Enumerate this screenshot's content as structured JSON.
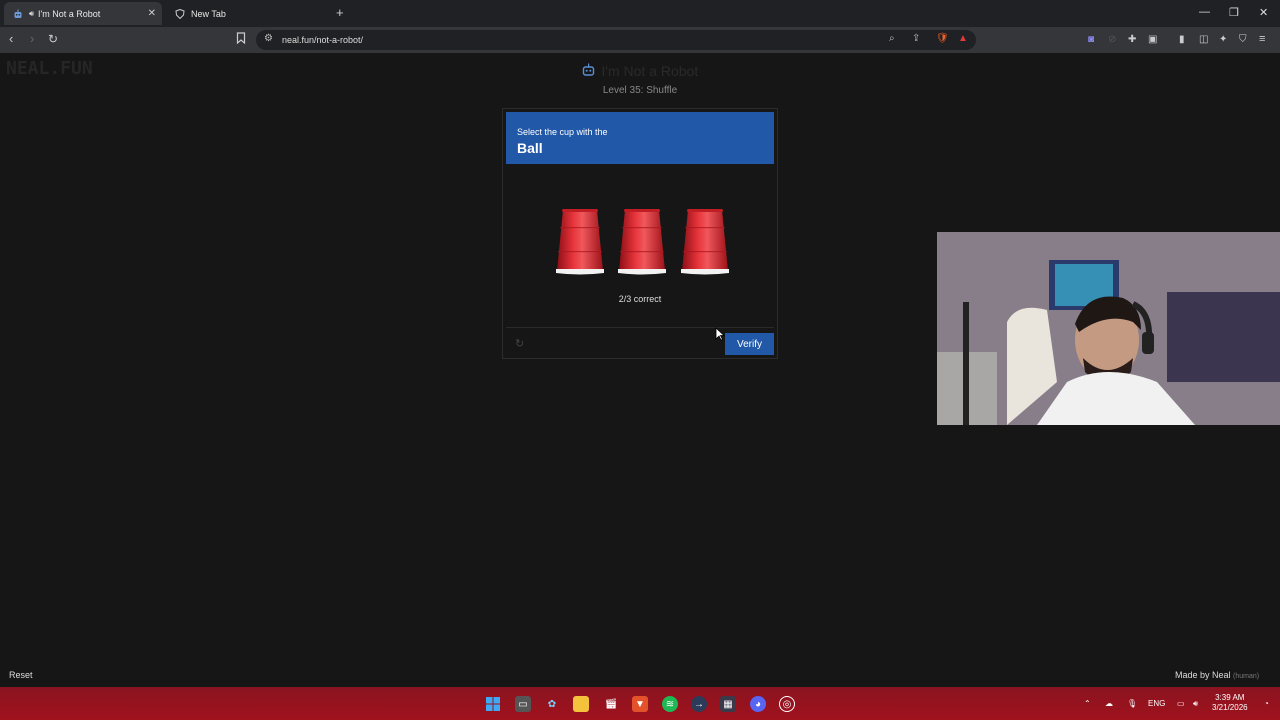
{
  "browser": {
    "tabs": [
      {
        "title": "I'm Not a Robot",
        "active": true
      },
      {
        "title": "New Tab",
        "active": false
      }
    ],
    "url": "neal.fun/not-a-robot/"
  },
  "page": {
    "logo": "NEAL.FUN",
    "title": "I'm Not a Robot",
    "level": "Level 35: Shuffle",
    "captcha": {
      "instruction": "Select the cup with the",
      "target": "Ball",
      "cups": 3,
      "status": "2/3 correct",
      "verify_label": "Verify"
    },
    "reset_label": "Reset",
    "made_by": "Made by Neal",
    "made_by_note": "(human)"
  },
  "taskbar": {
    "language": "ENG",
    "time": "3:39 AM",
    "date": "3/21/2026"
  },
  "colors": {
    "accent": "#2158a8",
    "cup": "#d8202a",
    "taskbar": "#a0121d"
  }
}
